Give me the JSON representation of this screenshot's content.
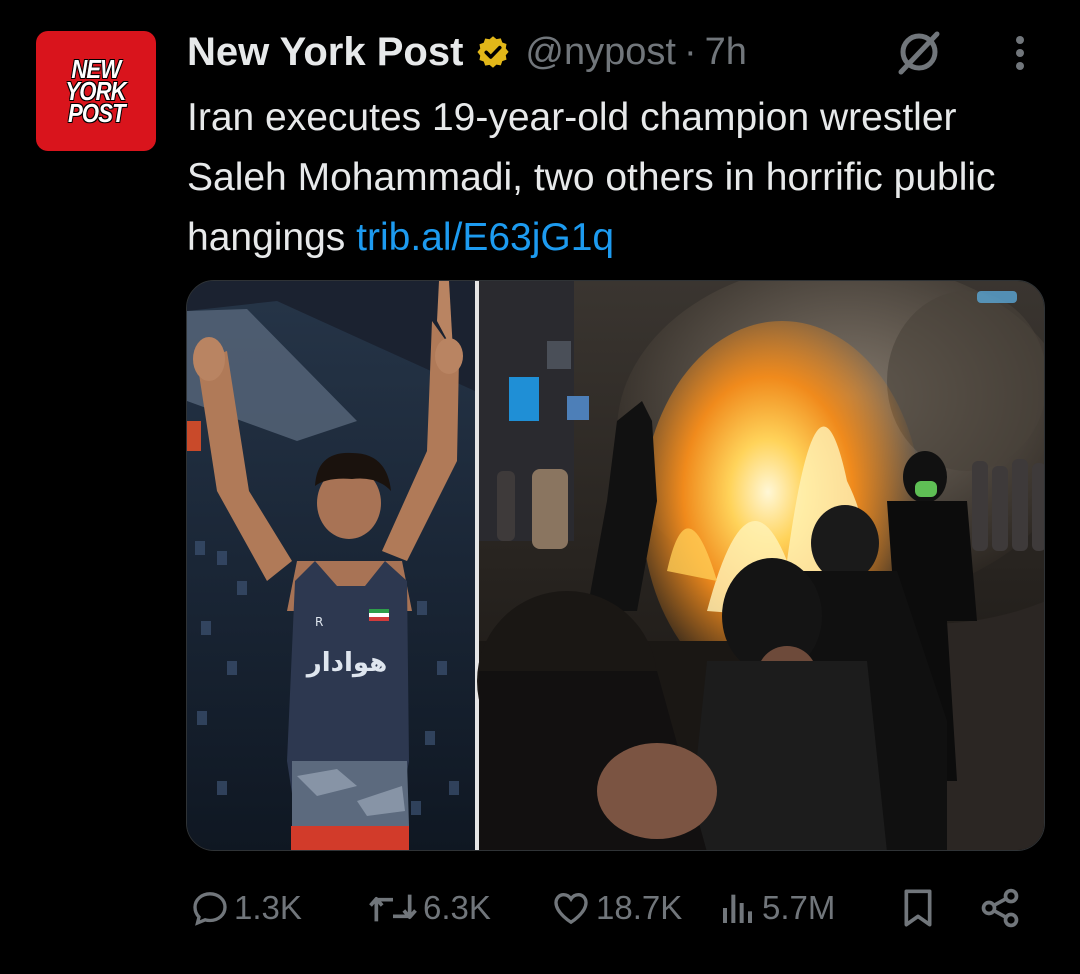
{
  "post": {
    "avatar_text": [
      "NEW",
      "YORK",
      "POST"
    ],
    "account_name": "New York Post",
    "handle": "@nypost",
    "separator": "·",
    "time": "7h",
    "text": "Iran executes 19-year-old champion wrestler Saleh Mohammadi, two others in horrific public hangings ",
    "link": "trib.al/E63jG1q"
  },
  "icons": {
    "verified": "gold-verified-badge-icon",
    "grok": "grok-icon",
    "more": "more-options-icon",
    "reply": "reply-icon",
    "repost": "repost-icon",
    "like": "like-icon",
    "views": "views-icon",
    "bookmark": "bookmark-icon",
    "share": "share-icon"
  },
  "media": {
    "left_image": "wrestler-arms-raised-photo",
    "right_image": "street-bonfire-protest-photo",
    "jersey_text": "هوادار"
  },
  "actions": {
    "replies": "1.3K",
    "reposts": "6.3K",
    "likes": "18.7K",
    "views": "5.7M"
  },
  "colors": {
    "background": "#000000",
    "text": "#e7e9ea",
    "secondary": "#71767b",
    "link": "#1d9bf0",
    "brand_red": "#d9141c",
    "verified_gold": "#e2b719"
  }
}
